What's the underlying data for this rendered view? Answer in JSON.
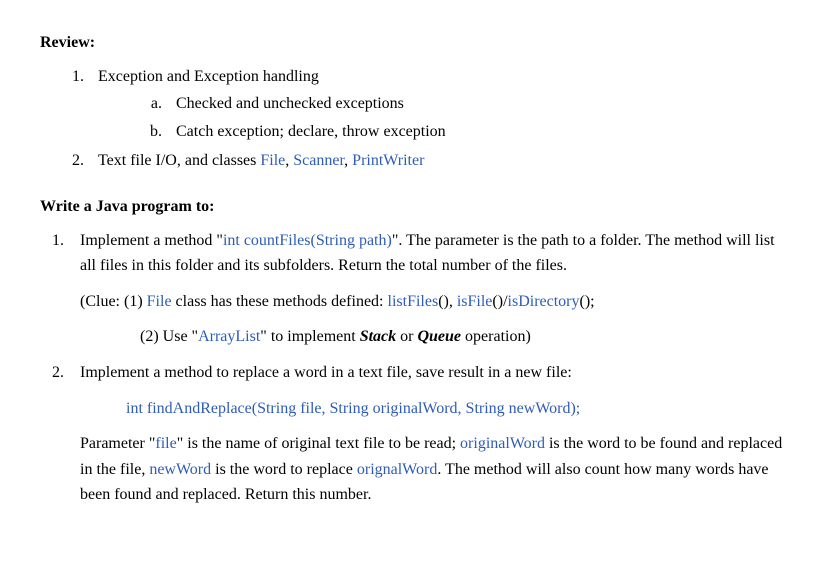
{
  "review": {
    "heading": "Review:",
    "items": {
      "one": "Exception and Exception handling",
      "one_a": "Checked and unchecked exceptions",
      "one_b": "Catch exception; declare, throw exception",
      "two_prefix": "Text file I/O, and classes ",
      "two_file": "File",
      "two_sep1": ", ",
      "two_scanner": "Scanner",
      "two_sep2": ", ",
      "two_printwriter": "PrintWriter"
    }
  },
  "program": {
    "heading": "Write a Java program to:",
    "task1": {
      "p1_a": "Implement a method \"",
      "p1_b": "int countFiles(String path)",
      "p1_c": "\". The parameter is the path to a folder. The method will list all files in this folder and its subfolders. Return the total number of the files.",
      "clue_a": "(Clue: (1) ",
      "clue_b": "File",
      "clue_c": " class has these methods defined: ",
      "clue_d": "listFiles",
      "clue_e": "(), ",
      "clue_f": "isFile",
      "clue_g": "()/",
      "clue_h": "isDirectory",
      "clue_i": "();",
      "clue2_a": "(2) Use \"",
      "clue2_b": "ArrayList",
      "clue2_c": "\" to implement ",
      "clue2_d": "Stack",
      "clue2_e": " or ",
      "clue2_f": "Queue",
      "clue2_g": " operation)"
    },
    "task2": {
      "p1": "Implement a method to replace a word in a text file, save result in a new file:",
      "method": "int findAndReplace(String file, String originalWord, String newWord);",
      "p2_a": "Parameter \"",
      "p2_b": "file",
      "p2_c": "\" is the name of original text file to be read; ",
      "p2_d": "originalWord",
      "p2_e": " is the word to be found and replaced in the file, ",
      "p2_f": "newWord",
      "p2_g": " is the word to replace ",
      "p2_h": "orignalWord",
      "p2_i": ". The method will also count how many words have been found and replaced. Return this number."
    }
  }
}
